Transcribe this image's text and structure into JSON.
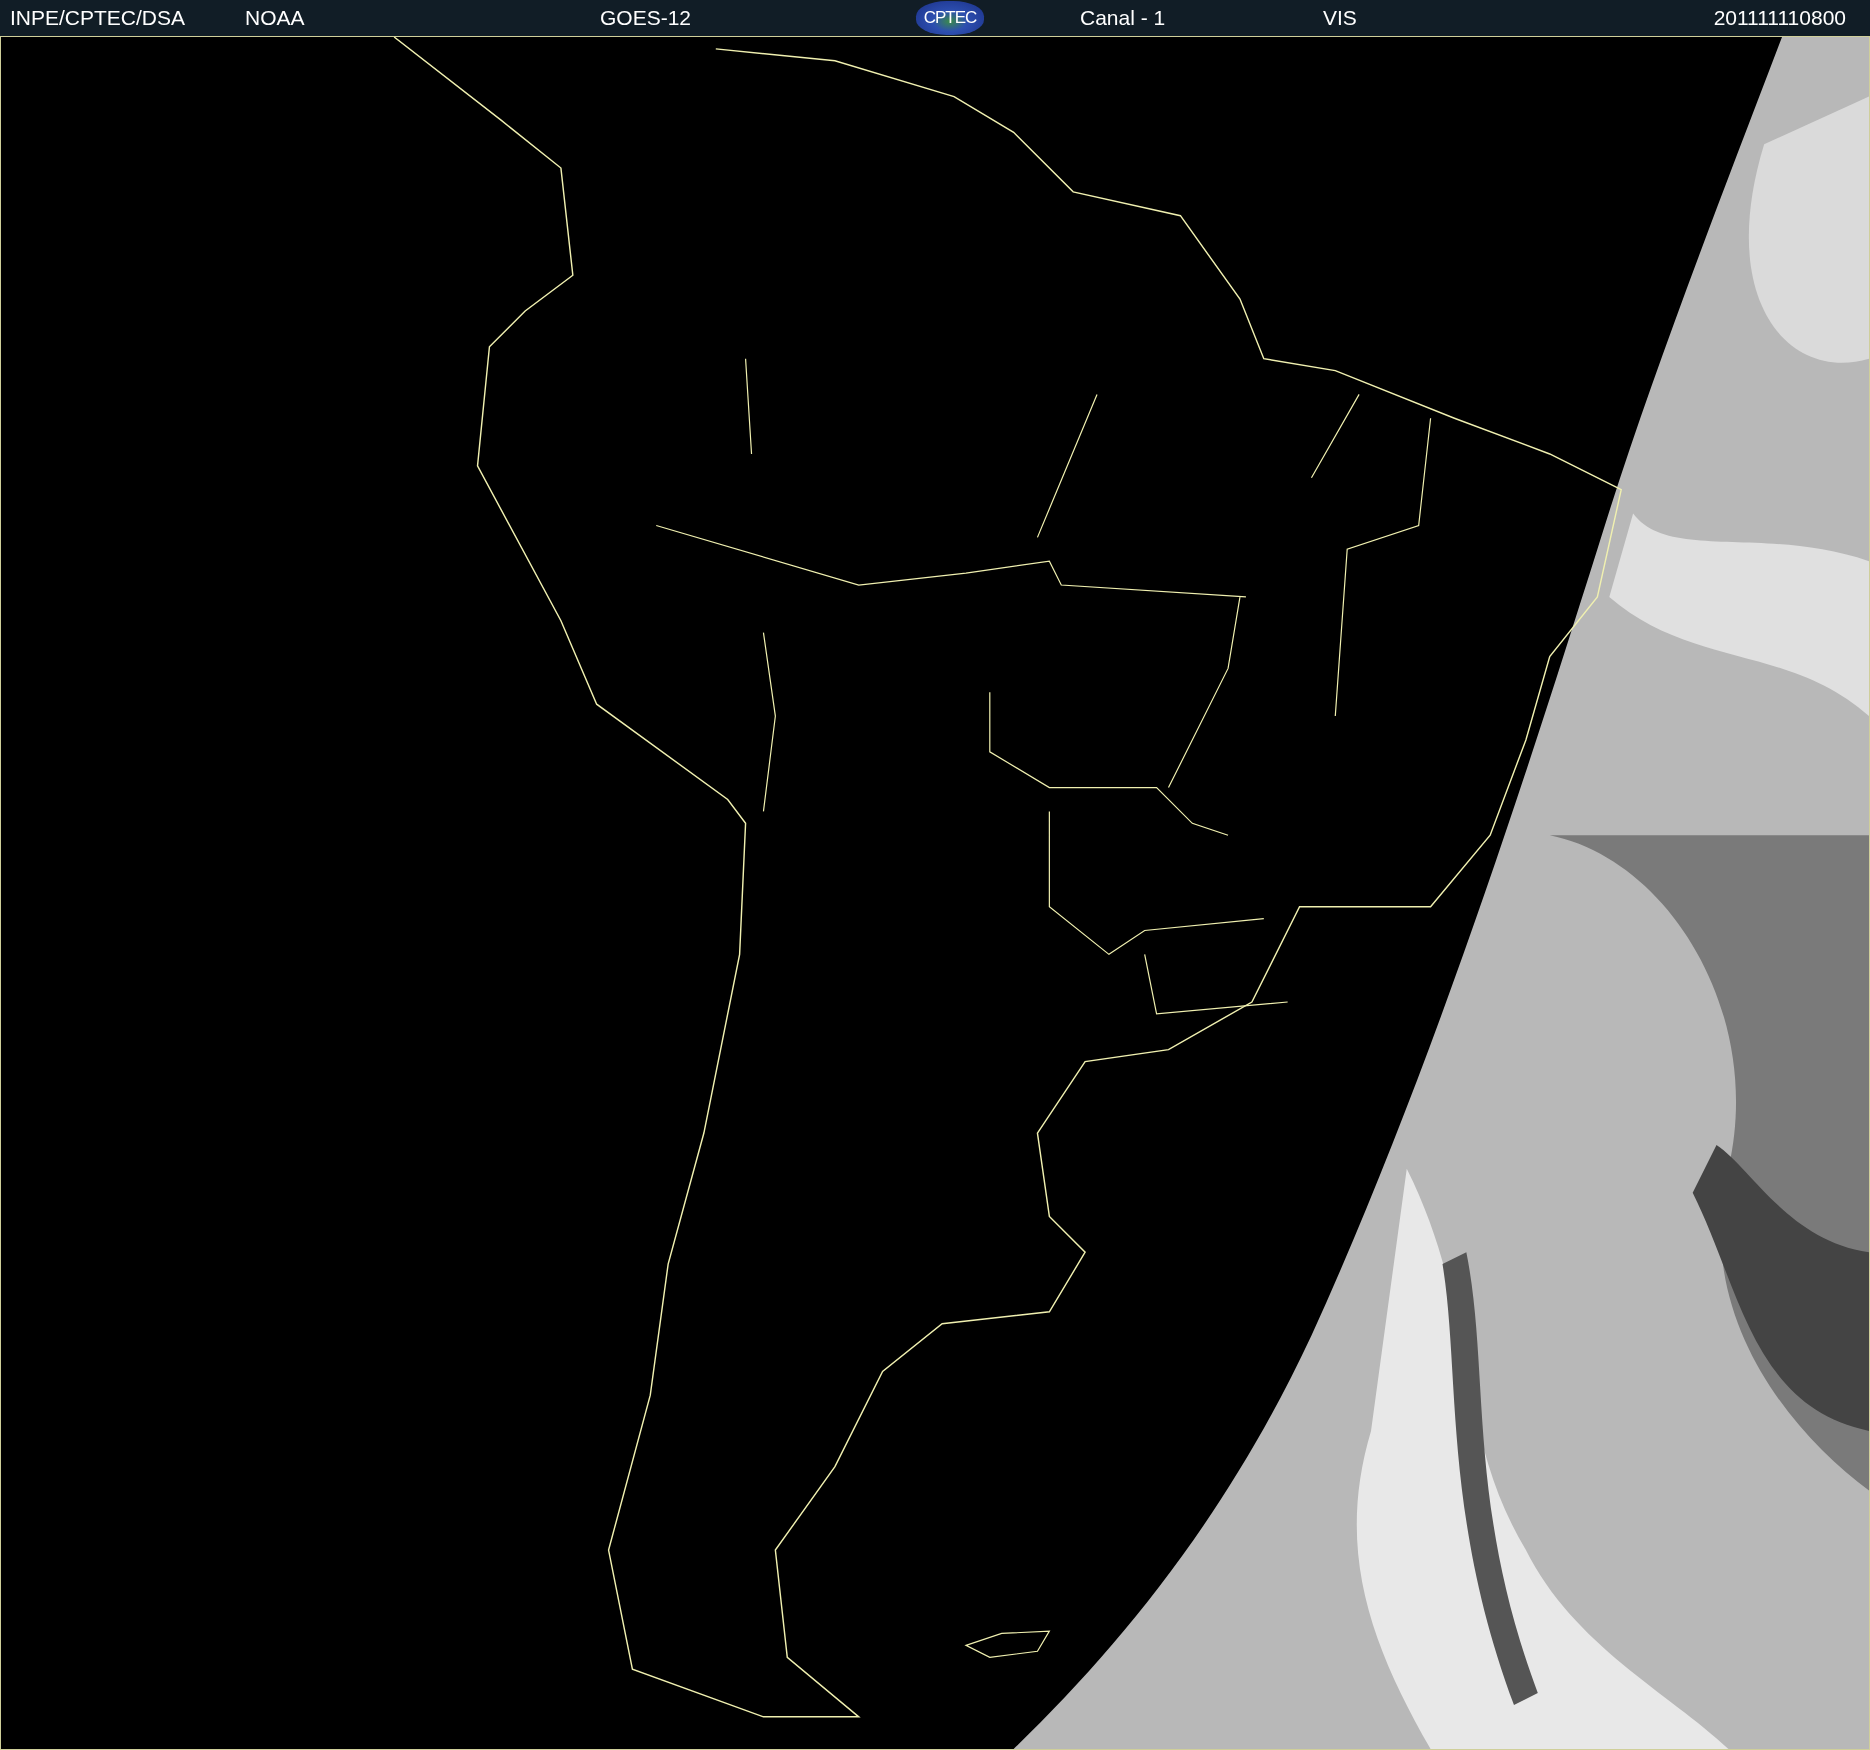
{
  "header": {
    "institution": "INPE/CPTEC/DSA",
    "agency": "NOAA",
    "satellite": "GOES-12",
    "logo": "CPTEC",
    "channel": "Canal - 1",
    "band": "VIS",
    "timestamp": "201111110800"
  }
}
